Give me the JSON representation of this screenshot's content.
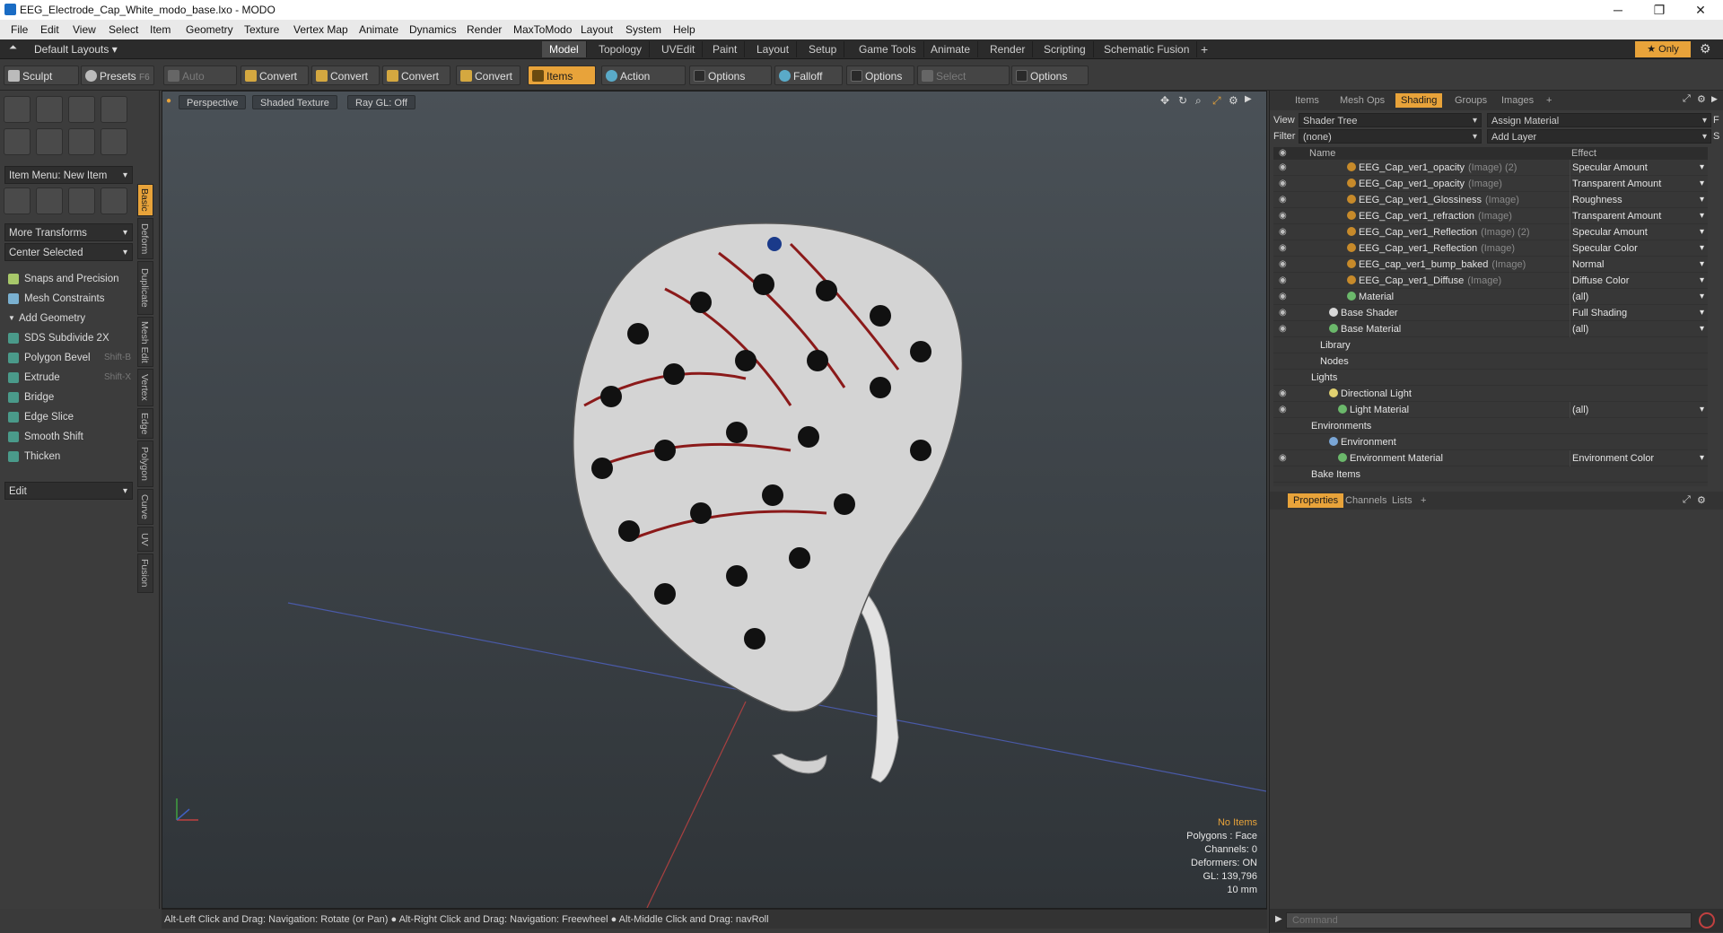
{
  "window": {
    "title": "EEG_Electrode_Cap_White_modo_base.lxo - MODO",
    "minimize": "─",
    "maximize": "❐",
    "close": "✕"
  },
  "menu": [
    "File",
    "Edit",
    "View",
    "Select",
    "Item",
    "Geometry",
    "Texture",
    "Vertex Map",
    "Animate",
    "Dynamics",
    "Render",
    "MaxToModo",
    "Layout",
    "System",
    "Help"
  ],
  "layouts": {
    "preset": "Default Layouts ▾",
    "tabs": [
      "Model",
      "Topology",
      "UVEdit",
      "Paint",
      "Layout",
      "Setup",
      "Game Tools",
      "Animate",
      "Render",
      "Scripting",
      "Schematic Fusion",
      "+"
    ],
    "active": "Model",
    "only": "★  Only"
  },
  "toolbar": {
    "sculpt": "Sculpt",
    "presets": "Presets",
    "presets_key": "F6",
    "auto_select": "Auto Select",
    "convert": "Convert",
    "items": "Items",
    "action_center": "Action Center",
    "options": "Options",
    "falloff": "Falloff",
    "select_through": "Select Through"
  },
  "left_panel": {
    "item_menu": "Item Menu: New Item",
    "more_transforms": "More Transforms",
    "center_selected": "Center Selected",
    "snaps": "Snaps and Precision",
    "mesh_constraints": "Mesh Constraints",
    "add_geometry": "Add Geometry",
    "tools": [
      {
        "label": "SDS Subdivide 2X",
        "key": ""
      },
      {
        "label": "Polygon Bevel",
        "key": "Shift-B"
      },
      {
        "label": "Extrude",
        "key": "Shift-X"
      },
      {
        "label": "Bridge",
        "key": ""
      },
      {
        "label": "Edge Slice",
        "key": ""
      },
      {
        "label": "Smooth Shift",
        "key": ""
      },
      {
        "label": "Thicken",
        "key": ""
      }
    ],
    "edit": "Edit",
    "vtabs": [
      "Basic",
      "Deform",
      "Duplicate",
      "Mesh Edit",
      "Vertex",
      "Edge",
      "Polygon",
      "Curve",
      "UV",
      "Fusion"
    ]
  },
  "viewport": {
    "view": "Perspective",
    "shading": "Shaded Texture",
    "raygl": "Ray GL: Off",
    "hud": {
      "items": "No Items",
      "polygons": "Polygons : Face",
      "channels": "Channels: 0",
      "deformers": "Deformers: ON",
      "gl": "GL: 139,796",
      "scale": "10 mm"
    }
  },
  "status": "Alt-Left Click and Drag: Navigation: Rotate (or Pan) ● Alt-Right Click and Drag: Navigation: Freewheel ● Alt-Middle Click and Drag: navRoll",
  "right_panel": {
    "tabs": [
      "Items",
      "Mesh Ops",
      "Shading",
      "Groups",
      "Images",
      "+"
    ],
    "active_tab": "Shading",
    "view_label": "View",
    "view_value": "Shader Tree",
    "assign": "Assign Material",
    "f_key": "F",
    "filter_label": "Filter",
    "filter_value": "(none)",
    "add_layer": "Add Layer",
    "s_key": "S",
    "col_name": "Name",
    "col_effect": "Effect",
    "rows": [
      {
        "name": "EEG_Cap_ver1_opacity",
        "sub": "(Image) (2)",
        "effect": "Specular Amount",
        "indent": 58,
        "dot": "#c78a2a",
        "eye": true,
        "dd": true
      },
      {
        "name": "EEG_Cap_ver1_opacity",
        "sub": "(Image)",
        "effect": "Transparent Amount",
        "indent": 58,
        "dot": "#c78a2a",
        "eye": true,
        "dd": true
      },
      {
        "name": "EEG_Cap_ver1_Glossiness",
        "sub": "(Image)",
        "effect": "Roughness",
        "indent": 58,
        "dot": "#c78a2a",
        "eye": true,
        "dd": true
      },
      {
        "name": "EEG_Cap_ver1_refraction",
        "sub": "(Image)",
        "effect": "Transparent Amount",
        "indent": 58,
        "dot": "#c78a2a",
        "eye": true,
        "dd": true
      },
      {
        "name": "EEG_Cap_ver1_Reflection",
        "sub": "(Image) (2)",
        "effect": "Specular Amount",
        "indent": 58,
        "dot": "#c78a2a",
        "eye": true,
        "dd": true
      },
      {
        "name": "EEG_Cap_ver1_Reflection",
        "sub": "(Image)",
        "effect": "Specular Color",
        "indent": 58,
        "dot": "#c78a2a",
        "eye": true,
        "dd": true
      },
      {
        "name": "EEG_cap_ver1_bump_baked",
        "sub": "(Image)",
        "effect": "Normal",
        "indent": 58,
        "dot": "#c78a2a",
        "eye": true,
        "dd": true
      },
      {
        "name": "EEG_Cap_ver1_Diffuse",
        "sub": "(Image)",
        "effect": "Diffuse Color",
        "indent": 58,
        "dot": "#c78a2a",
        "eye": true,
        "dd": true
      },
      {
        "name": "Material",
        "sub": "",
        "effect": "(all)",
        "indent": 58,
        "dot": "#6bb86b",
        "eye": true,
        "dd": true
      },
      {
        "name": "Base Shader",
        "sub": "",
        "effect": "Full Shading",
        "indent": 38,
        "dot": "#d8d8d8",
        "eye": true,
        "dd": true
      },
      {
        "name": "Base Material",
        "sub": "",
        "effect": "(all)",
        "indent": 38,
        "dot": "#6bb86b",
        "eye": true,
        "dd": true
      },
      {
        "name": "Library",
        "sub": "",
        "effect": "",
        "indent": 28,
        "dot": "",
        "eye": false,
        "dd": false
      },
      {
        "name": "Nodes",
        "sub": "",
        "effect": "",
        "indent": 28,
        "dot": "",
        "eye": false,
        "dd": false
      },
      {
        "name": "Lights",
        "sub": "",
        "effect": "",
        "indent": 18,
        "dot": "",
        "eye": false,
        "dd": false
      },
      {
        "name": "Directional Light",
        "sub": "",
        "effect": "",
        "indent": 38,
        "dot": "#e0d070",
        "eye": true,
        "dd": false
      },
      {
        "name": "Light Material",
        "sub": "",
        "effect": "(all)",
        "indent": 48,
        "dot": "#6bb86b",
        "eye": true,
        "dd": true
      },
      {
        "name": "Environments",
        "sub": "",
        "effect": "",
        "indent": 18,
        "dot": "",
        "eye": false,
        "dd": false
      },
      {
        "name": "Environment",
        "sub": "",
        "effect": "",
        "indent": 38,
        "dot": "#7aa6d6",
        "eye": false,
        "dd": false
      },
      {
        "name": "Environment Material",
        "sub": "",
        "effect": "Environment Color",
        "indent": 48,
        "dot": "#6bb86b",
        "eye": true,
        "dd": true
      },
      {
        "name": "Bake Items",
        "sub": "",
        "effect": "",
        "indent": 18,
        "dot": "",
        "eye": false,
        "dd": false
      }
    ],
    "bottom_tabs": [
      "Properties",
      "Channels",
      "Lists",
      "+"
    ],
    "command_placeholder": "Command"
  }
}
